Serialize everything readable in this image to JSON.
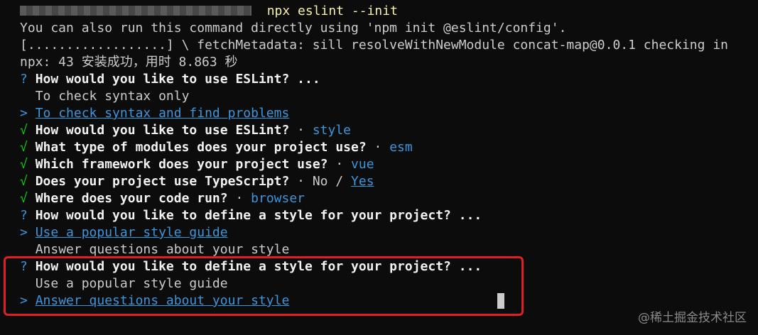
{
  "terminal": {
    "prompt_command": "npx eslint --init",
    "lines": [
      {
        "text": "You can also run this command directly using 'npm init @eslint/config'."
      },
      {
        "text": "[..................] \\ fetchMetadata: sill resolveWithNewModule concat-map@0.0.1 checking in"
      },
      {
        "text": "npx: 43 安装成功，用时 8.863 秒"
      }
    ],
    "q1": {
      "mark": "?",
      "question": "How would you like to use ESLint?",
      "suffix": " ...",
      "option1": "To check syntax only",
      "pointer": ">",
      "option2": "To check syntax and find problems"
    },
    "answered": [
      {
        "mark": "√",
        "question": "How would you like to use ESLint?",
        "sep": " · ",
        "answer": "style"
      },
      {
        "mark": "√",
        "question": "What type of modules does your project use?",
        "sep": " · ",
        "answer": "esm"
      },
      {
        "mark": "√",
        "question": "Which framework does your project use?",
        "sep": " · ",
        "answer": "vue"
      },
      {
        "mark": "√",
        "question": "Does your project use TypeScript?",
        "sep": " · ",
        "answer_no": "No",
        "slash": " / ",
        "answer_yes": "Yes"
      },
      {
        "mark": "√",
        "question": "Where does your code run?",
        "sep": " · ",
        "answer": "browser"
      }
    ],
    "q2": {
      "mark": "?",
      "question": "How would you like to define a style for your project?",
      "suffix": " ...",
      "pointer": ">",
      "option1": "Use a popular style guide",
      "option2": "Answer questions about your style"
    },
    "q3": {
      "mark": "?",
      "question": "How would you like to define a style for your project?",
      "suffix": " ...",
      "option1": "Use a popular style guide",
      "pointer": ">",
      "option2": "Answer questions about your style"
    },
    "watermark": "@稀土掘金技术社区"
  },
  "colors": {
    "background": "#0c0c0c",
    "cyan": "#3a96dd",
    "green": "#16c60c",
    "prompt_yellow": "#f9f1a5",
    "highlight_red": "#e02020"
  }
}
